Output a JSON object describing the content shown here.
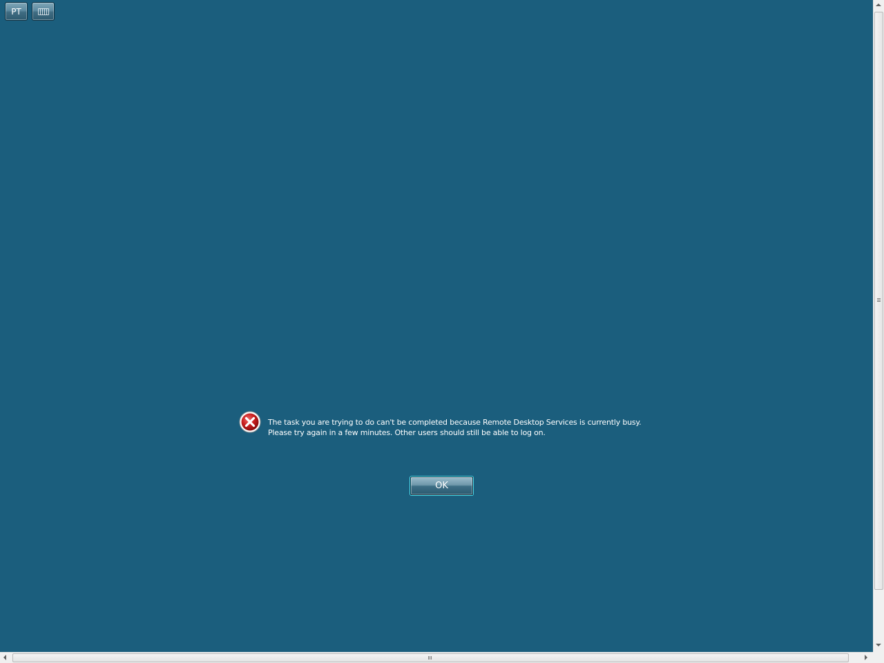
{
  "toolbar": {
    "language_label": "PT",
    "keyboard_icon": "keyboard-icon"
  },
  "dialog": {
    "icon": "error-icon",
    "message_line1": "The task you are trying to do can't be completed because Remote Desktop Services is currently busy.",
    "message_line2": "Please try again in a few minutes. Other users should still be able to log on.",
    "ok_label": "OK"
  },
  "colors": {
    "background": "#1b5e7d",
    "error_red": "#c81e1e",
    "focus_ring": "#4fe3f3"
  }
}
